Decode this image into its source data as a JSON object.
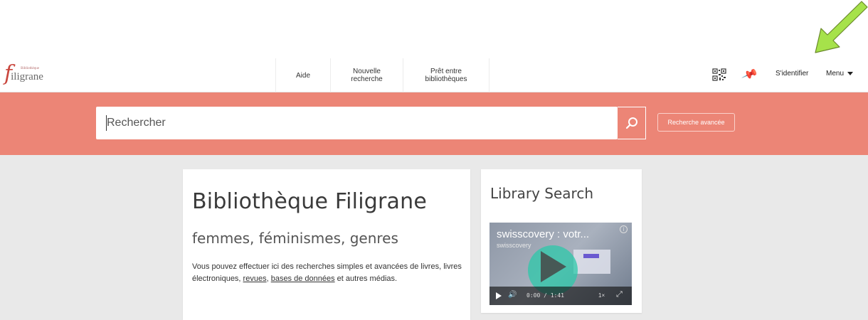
{
  "logo": {
    "letter": "f",
    "name": "iligrane",
    "tagline": "Bibliothèque"
  },
  "nav": {
    "aide": "Aide",
    "nouvelle_line1": "Nouvelle",
    "nouvelle_line2": "recherche",
    "pret_line1": "Prêt entre",
    "pret_line2": "bibliothèques"
  },
  "tools": {
    "signin": "S'identifier",
    "menu": "Menu"
  },
  "search": {
    "placeholder": "Rechercher",
    "advanced_label": "Recherche avancée"
  },
  "main": {
    "title": "Bibliothèque Filigrane",
    "subtitle": "femmes, féminismes, genres",
    "desc_part1": "Vous pouvez effectuer ici des recherches simples et avancées de livres, livres électroniques, ",
    "link_revues": "revues",
    "desc_part2": ", ",
    "link_bases": "bases de données",
    "desc_part3": " et autres médias."
  },
  "side": {
    "title": "Library Search",
    "video_title": "swisscovery : votr...",
    "video_sub": "swisscovery",
    "time": "0:00 / 1:41",
    "speed": "1×"
  },
  "colors": {
    "accent": "#ec8576",
    "background": "#e9e9e9",
    "logo": "#c9463d",
    "arrow": "#a6e24a"
  }
}
